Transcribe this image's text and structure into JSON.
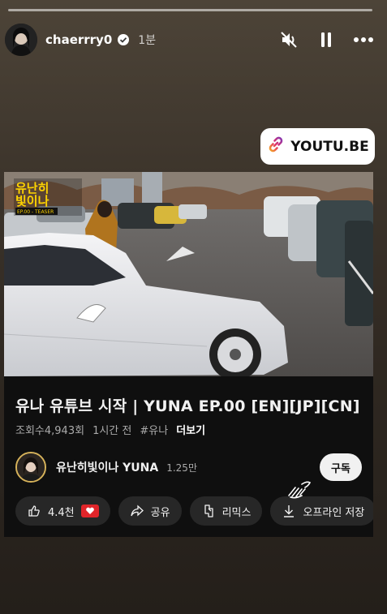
{
  "story": {
    "username": "chaerrry0",
    "time": "1분",
    "verified": true,
    "icons": [
      "mute-icon",
      "pause-icon",
      "more-icon"
    ]
  },
  "link_sticker": {
    "text": "YOUTU.BE",
    "icon": "link-icon"
  },
  "video": {
    "thumbnail_logo_line1": "유난히",
    "thumbnail_logo_line2": "빛이나",
    "thumbnail_tag": "EP.00 - TEASER",
    "title": "유나 유튜브 시작 | YUNA EP.00 [EN][JP][CN]",
    "views": "조회수4,943회",
    "uploaded": "1시간 전",
    "hashtag": "#유나",
    "more": "더보기"
  },
  "channel": {
    "name": "유난히빛이나 YUNA",
    "subscribers": "1.25만",
    "subscribe_label": "구독"
  },
  "actions": {
    "like_count": "4.4천",
    "share": "공유",
    "remix": "리믹스",
    "download": "오프라인 저장"
  },
  "colors": {
    "accent_red": "#e0252a",
    "card_bg": "#0f0f0f",
    "pill_bg": "#272727"
  }
}
